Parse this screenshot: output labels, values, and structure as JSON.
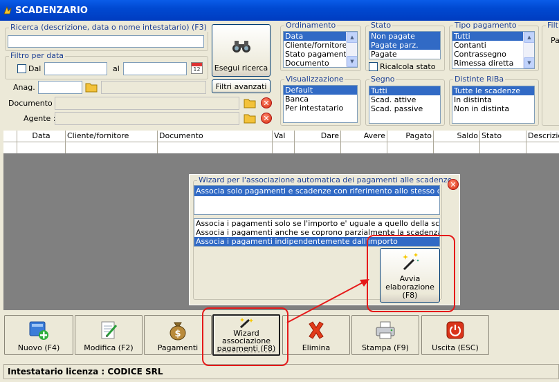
{
  "window": {
    "title": "SCADENZARIO"
  },
  "search": {
    "caption": "Ricerca (descrizione, data o nome intestatario) (F3)",
    "value": ""
  },
  "date_filter": {
    "caption": "Filtro per data",
    "dal_label": "Dal",
    "al_label": "al",
    "dal_value": "",
    "al_value": ""
  },
  "search_button": {
    "label": "Esegui ricerca"
  },
  "anag": {
    "label": "Anag. :",
    "code": "",
    "name": ""
  },
  "advanced_filters": {
    "label": "Filtri avanzati"
  },
  "documento": {
    "label": "Documento :",
    "value": ""
  },
  "agente": {
    "label": "Agente :",
    "value": ""
  },
  "ordinamento": {
    "caption": "Ordinamento",
    "items": [
      "Data",
      "Cliente/fornitore",
      "Stato pagamento",
      "Documento"
    ],
    "selected": 0
  },
  "stato": {
    "caption": "Stato",
    "items": [
      "Non pagate",
      "Pagate parz.",
      "Pagate"
    ],
    "selected": [
      0,
      1
    ],
    "ricalcola_label": "Ricalcola stato"
  },
  "tipo_pagamento": {
    "caption": "Tipo pagamento",
    "items": [
      "Tutti",
      "Contanti",
      "Contrassegno",
      "Rimessa diretta"
    ],
    "selected": 0
  },
  "visualizzazione": {
    "caption": "Visualizzazione",
    "items": [
      "Default",
      "Banca",
      "Per intestatario"
    ],
    "selected": 0
  },
  "segno": {
    "caption": "Segno",
    "items": [
      "Tutti",
      "Scad. attive",
      "Scad. passive"
    ],
    "selected": 0
  },
  "distinte": {
    "caption": "Distinte RiBa",
    "items": [
      "Tutte le scadenze",
      "In distinta",
      "Non in distinta"
    ],
    "selected": 0
  },
  "filtri_cut": {
    "caption": "Filtri",
    "sub": "Pa"
  },
  "grid": {
    "columns": [
      "Data",
      "Cliente/fornitore",
      "Documento",
      "Val",
      "Dare",
      "Avere",
      "Pagato",
      "Saldo",
      "Stato",
      "Descrizio"
    ]
  },
  "wizard": {
    "caption": "Wizard per l'associazione automatica dei pagamenti alle scadenze",
    "option_top": "Associa solo pagamenti e scadenze con riferimento allo stesso documento",
    "options": [
      "Associa i pagamenti solo se l'importo e' uguale a quello della scadenza",
      "Associa i pagamenti anche se coprono parzialmente la scadenza",
      "Associa i pagamenti indipendentemente dall'importo"
    ],
    "selected": 2,
    "start_button": {
      "line1": "Avvia",
      "line2": "elaborazione",
      "line3": "(F8)"
    }
  },
  "toolbar": {
    "nuovo": "Nuovo (F4)",
    "modifica": "Modifica (F2)",
    "pagamenti": "Pagamenti",
    "wizard_l1": "Wizard",
    "wizard_l2": "associazione",
    "wizard_l3": "pagamenti (F8)",
    "elimina": "Elimina",
    "stampa": "Stampa (F9)",
    "uscita": "Uscita (ESC)"
  },
  "status": {
    "text": "Intestatario licenza : CODICE SRL"
  },
  "colors": {
    "accent": "#316ac5",
    "highlight": "#e51a1a",
    "title": "#0054e3"
  }
}
